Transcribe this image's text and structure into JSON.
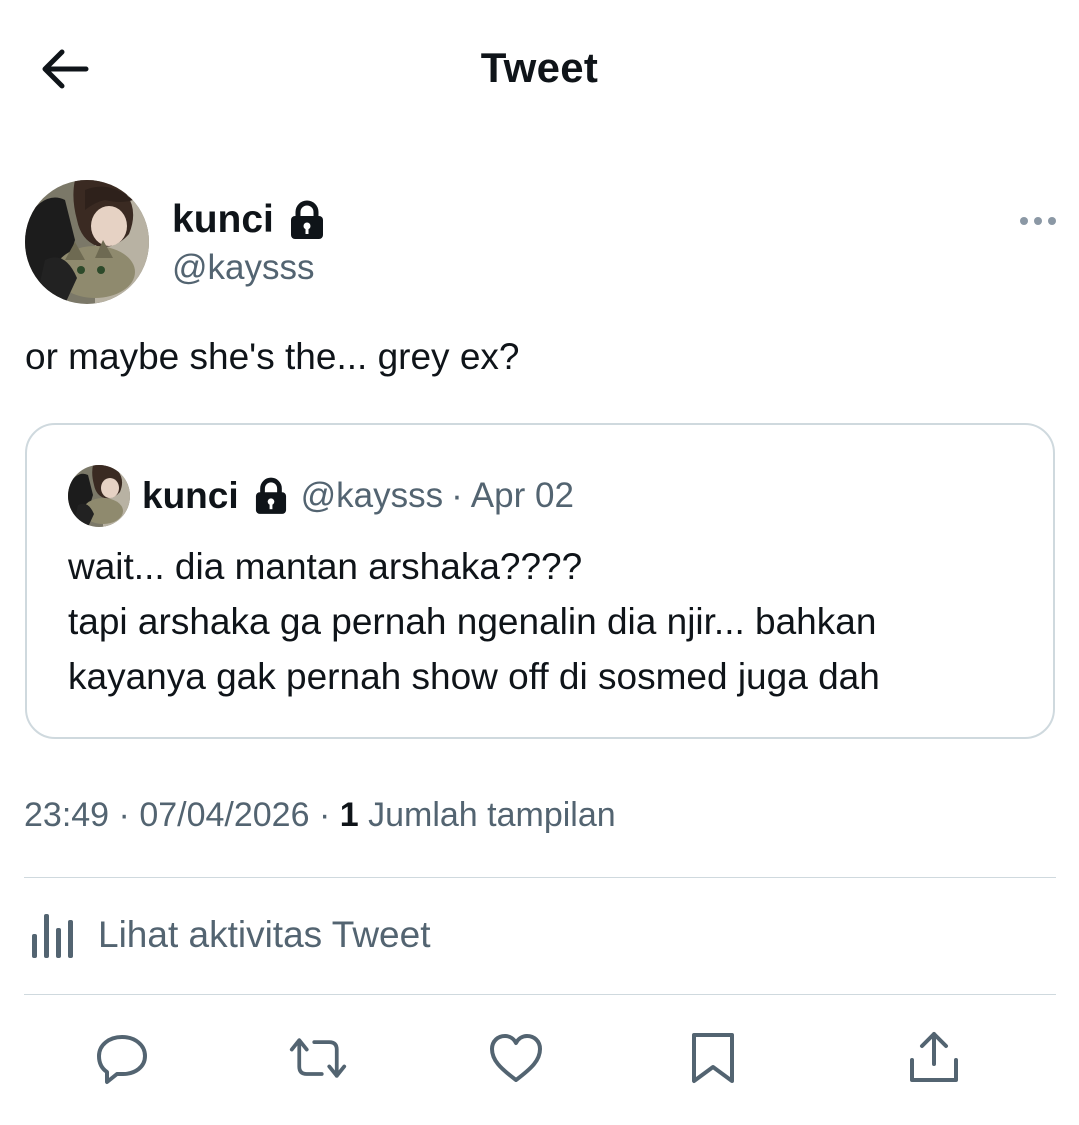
{
  "header": {
    "title": "Tweet",
    "back_icon": "arrow-left-icon"
  },
  "author": {
    "name": "kunci",
    "handle": "@kaysss",
    "protected_icon": "lock-icon"
  },
  "tweet": {
    "text": "or maybe she's the... grey ex?"
  },
  "quoted_tweet": {
    "name": "kunci",
    "handle": "@kaysss",
    "separator": "·",
    "date": "Apr 02",
    "lines": [
      "wait... dia mantan arshaka????",
      "tapi arshaka ga pernah ngenalin dia njir... bahkan",
      "kayanya gak pernah show off di sosmed juga dah"
    ]
  },
  "meta": {
    "time": "23:49",
    "sep1": "·",
    "date": "07/04/2026",
    "sep2": "·",
    "views_count": "1",
    "views_label": "Jumlah tampilan"
  },
  "activity": {
    "label": "Lihat aktivitas Tweet",
    "icon": "analytics-bar-icon"
  },
  "actions": [
    "reply-icon",
    "retweet-icon",
    "like-icon",
    "bookmark-icon",
    "share-icon"
  ],
  "colors": {
    "text_primary": "#0f1419",
    "text_secondary": "#536471",
    "border": "#cfd9de"
  }
}
